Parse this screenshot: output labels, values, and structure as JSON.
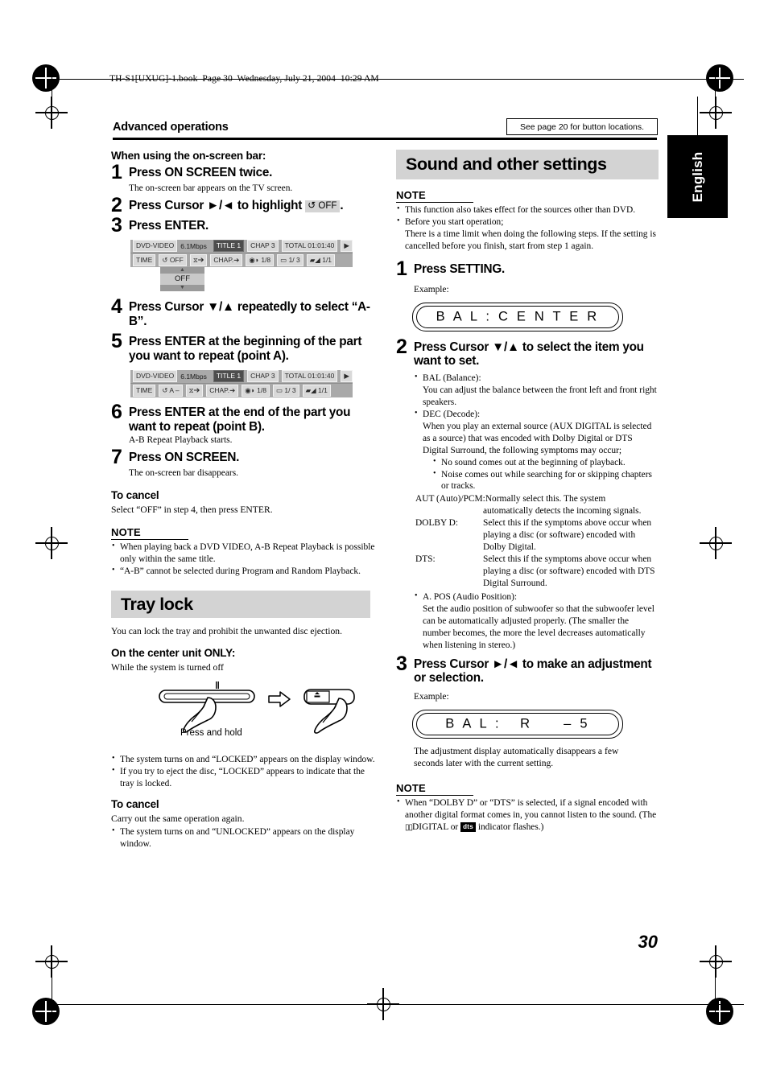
{
  "header": {
    "bookline": "TH-S1[UXUG]-1.book  Page 30  Wednesday, July 21, 2004  10:29 AM",
    "kicker": "Advanced operations",
    "see_page_box": "See page 20 for button locations.",
    "language_tab": "English"
  },
  "page_number": "30",
  "left_column": {
    "heading": "When using the on-screen bar:",
    "steps": [
      {
        "num": "1",
        "text": "Press ON SCREEN twice.",
        "desc": "The on-screen bar appears on the TV screen."
      },
      {
        "num": "2",
        "text_before": "Press Cursor ►/◄ to highlight ",
        "chip_loop": "↺",
        "chip_label": "OFF",
        "text_after": "."
      },
      {
        "num": "3",
        "text": "Press ENTER."
      },
      {
        "num": "4",
        "text": "Press Cursor ▼/▲ repeatedly to select “A-B”."
      },
      {
        "num": "5",
        "text": "Press ENTER at the beginning of the part you want to repeat (point A)."
      },
      {
        "num": "6",
        "text": "Press ENTER at the end of the part you want to repeat (point B).",
        "desc": "A-B Repeat Playback starts."
      },
      {
        "num": "7",
        "text": "Press ON SCREEN.",
        "desc": "The on-screen bar disappears."
      }
    ],
    "osd_bar_1": {
      "disc_type": "DVD-VIDEO",
      "bitrate": "6.1Mbps",
      "title": "TITLE  1",
      "chapter": "CHAP  3",
      "total": "TOTAL 01:01:40",
      "play_icon": "▶",
      "time_label": "TIME",
      "repeat_icon": "↺",
      "repeat_value": "OFF",
      "clock_icon": "⧖",
      "clock_arrow": "➔",
      "chap_label": "CHAP.",
      "chap_arrow": "➔",
      "audio_icon": "◉◗",
      "audio_value": "1/8",
      "subtitle_icon": "▭",
      "subtitle_value": "1/ 3",
      "angle_icon": "▰◢",
      "angle_value": "1/1",
      "dropdown_value": "OFF"
    },
    "osd_bar_2": {
      "disc_type": "DVD-VIDEO",
      "bitrate": "6.1Mbps",
      "title": "TITLE  1",
      "chapter": "CHAP  3",
      "total": "TOTAL 01:01:40",
      "play_icon": "▶",
      "time_label": "TIME",
      "repeat_icon": "↺",
      "repeat_value": "A –",
      "clock_icon": "⧖",
      "clock_arrow": "➔",
      "chap_label": "CHAP.",
      "chap_arrow": "➔",
      "audio_icon": "◉◗",
      "audio_value": "1/8",
      "subtitle_icon": "▭",
      "subtitle_value": "1/ 3",
      "angle_icon": "▰◢",
      "angle_value": "1/1"
    },
    "to_cancel_heading": "To cancel",
    "to_cancel_text": "Select “OFF” in step 4, then press ENTER.",
    "note_heading": "NOTE",
    "note_bullets": [
      "When playing back a DVD VIDEO, A-B Repeat Playback is possible only within the same title.",
      "“A-B” cannot be selected during Program and Random Playback."
    ],
    "tray_lock": {
      "banner": "Tray lock",
      "intro": "You can lock the tray and prohibit the unwanted disc ejection.",
      "sub_heading": "On the center unit ONLY:",
      "sub_text": "While the system is turned off",
      "illustration_caption": "Press and hold",
      "pause_icon": "‖",
      "eject_icon": "▲",
      "arrow_icon": "⇨",
      "bullets": [
        "The system turns on and “LOCKED” appears on the display window.",
        "If you try to eject the disc, “LOCKED” appears to indicate that the tray is locked."
      ],
      "to_cancel_heading": "To cancel",
      "to_cancel_text": "Carry out the same operation again.",
      "to_cancel_bullets": [
        "The system turns on and “UNLOCKED” appears on the display window."
      ]
    }
  },
  "right_column": {
    "banner": "Sound and other settings",
    "note_heading_top": "NOTE",
    "note_bullets_top": [
      "This function also takes effect for the sources other than DVD.",
      "Before you start operation;\nThere is a time limit when doing the following steps. If the setting is cancelled before you finish, start from step 1 again."
    ],
    "steps": [
      {
        "num": "1",
        "text": "Press SETTING.",
        "example_label": "Example:",
        "display": "B A L : C E N T E R"
      },
      {
        "num": "2",
        "text": "Press Cursor ▼/▲ to select the item you want to set."
      },
      {
        "num": "3",
        "text": "Press Cursor ►/◄ to make an adjustment or selection.",
        "example_label": "Example:",
        "display": "B A L :   R     – 5",
        "after": "The adjustment display automatically disappears a few seconds later with the current setting."
      }
    ],
    "item_bullets": [
      {
        "title": "BAL (Balance):",
        "body": "You can adjust the balance between the front left and front right speakers."
      },
      {
        "title": "DEC (Decode):",
        "body": "When you play an external source (AUX DIGITAL is selected as a source) that was encoded with Dolby Digital or DTS Digital Surround, the following symptoms may occur;",
        "subbullets": [
          "No sound comes out at the beginning of playback.",
          "Noise comes out while searching for or skipping chapters or tracks."
        ],
        "definitions": [
          {
            "term": "AUT (Auto)/PCM:",
            "inline": true,
            "def": "Normally select this. The system",
            "def2": "automatically detects the incoming signals."
          },
          {
            "term": "DOLBY D:",
            "def": "Select this if the symptoms above occur when playing a disc (or software) encoded with Dolby Digital."
          },
          {
            "term": "DTS:",
            "def": "Select this if the symptoms above occur when playing a disc (or software) encoded with DTS Digital Surround."
          }
        ]
      },
      {
        "title": "A. POS (Audio Position):",
        "body": "Set the audio position of subwoofer so that the subwoofer level can be automatically adjusted properly. (The smaller the number becomes, the more the level decreases automatically when listening in stereo.)"
      }
    ],
    "note_heading_bottom": "NOTE",
    "note_bottom_parts": {
      "part1": "When “DOLBY D” or “DTS” is selected, if a signal encoded with another digital format comes in, you cannot listen to the sound. (The ",
      "dolby_logo": "▯▯",
      "dolby_text": "DIGITAL",
      "mid": " or ",
      "dts_logo": "dts",
      "part2": " indicator flashes.)"
    }
  },
  "colors": {
    "banner_grey": "#d3d3d3",
    "osd_grey": "#a9a9a9",
    "tab_black": "#000000"
  }
}
